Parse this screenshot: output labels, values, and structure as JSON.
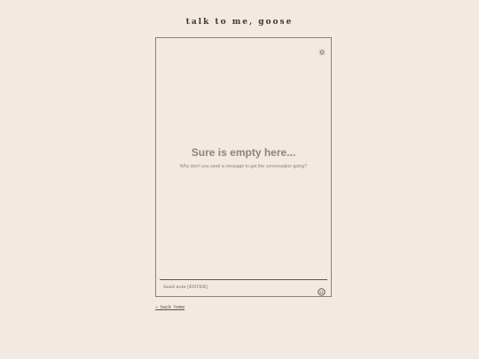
{
  "header": {
    "title": "talk to me, goose"
  },
  "chat": {
    "settings_icon": "gear-icon",
    "empty_heading": "Sure is empty here...",
    "empty_sub": "Why don't you send a message to get the conversation going?",
    "input_placeholder": "Send note [ENTER]",
    "input_value": "",
    "emoji_icon": "smiley-face-icon"
  },
  "footer": {
    "back_link": "← back home"
  },
  "colors": {
    "background": "#f3e9e1",
    "border": "#8b817b",
    "muted_text": "#8a8480"
  }
}
